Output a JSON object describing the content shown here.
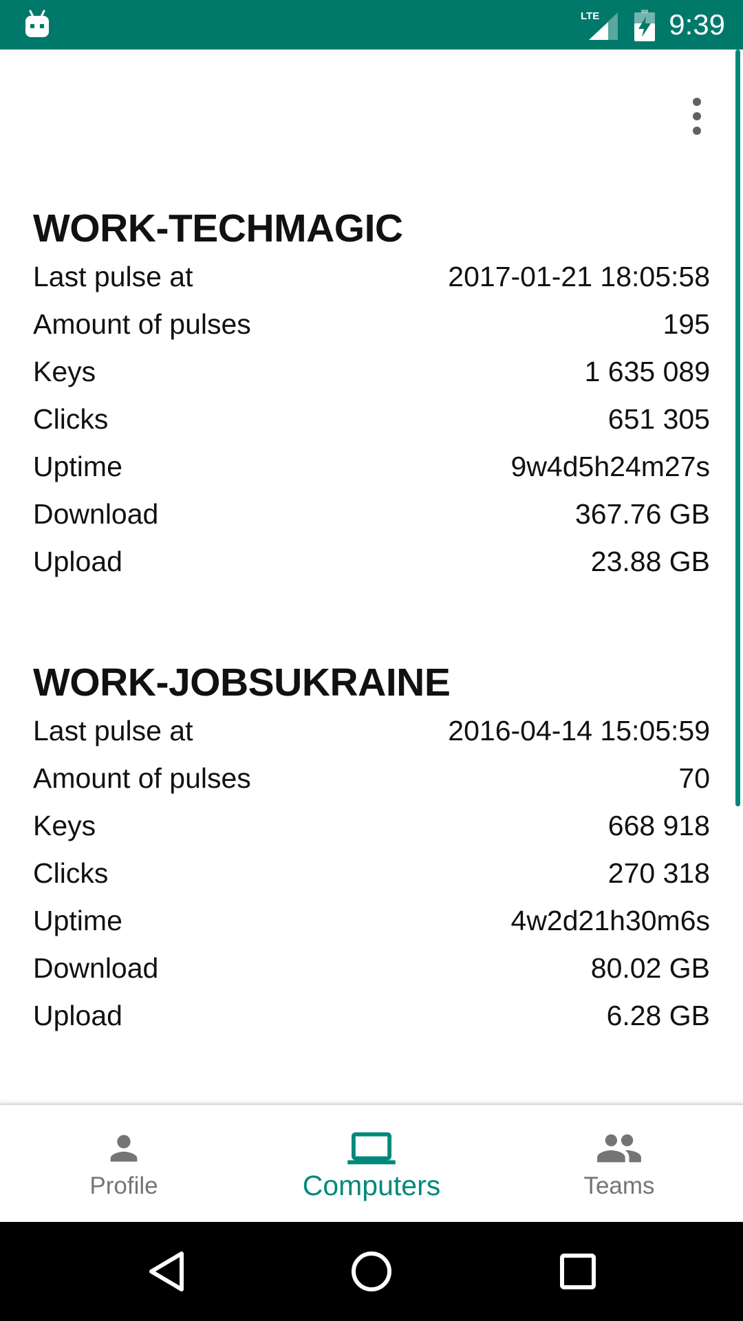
{
  "status_bar": {
    "time": "9:39",
    "network_label": "LTE"
  },
  "toolbar": {
    "overflow_icon": "more-vert-icon"
  },
  "computers": [
    {
      "name": "WORK-TECHMAGIC",
      "stats": [
        {
          "label": "Last pulse at",
          "value": "2017-01-21 18:05:58"
        },
        {
          "label": "Amount of pulses",
          "value": "195"
        },
        {
          "label": "Keys",
          "value": "1 635 089"
        },
        {
          "label": "Clicks",
          "value": "651 305"
        },
        {
          "label": "Uptime",
          "value": "9w4d5h24m27s"
        },
        {
          "label": "Download",
          "value": "367.76 GB"
        },
        {
          "label": "Upload",
          "value": "23.88 GB"
        }
      ]
    },
    {
      "name": "WORK-JOBSUKRAINE",
      "stats": [
        {
          "label": "Last pulse at",
          "value": "2016-04-14 15:05:59"
        },
        {
          "label": "Amount of pulses",
          "value": "70"
        },
        {
          "label": "Keys",
          "value": "668 918"
        },
        {
          "label": "Clicks",
          "value": "270 318"
        },
        {
          "label": "Uptime",
          "value": "4w2d21h30m6s"
        },
        {
          "label": "Download",
          "value": "80.02 GB"
        },
        {
          "label": "Upload",
          "value": "6.28 GB"
        }
      ]
    }
  ],
  "bottom_nav": {
    "active_tab": "Computers",
    "active_color": "#00897b",
    "items": [
      {
        "label": "Profile",
        "icon": "person-icon"
      },
      {
        "label": "Computers",
        "icon": "laptop-icon"
      },
      {
        "label": "Teams",
        "icon": "group-icon"
      }
    ]
  },
  "colors": {
    "status_bar": "#00796b",
    "accent": "#00897b"
  }
}
